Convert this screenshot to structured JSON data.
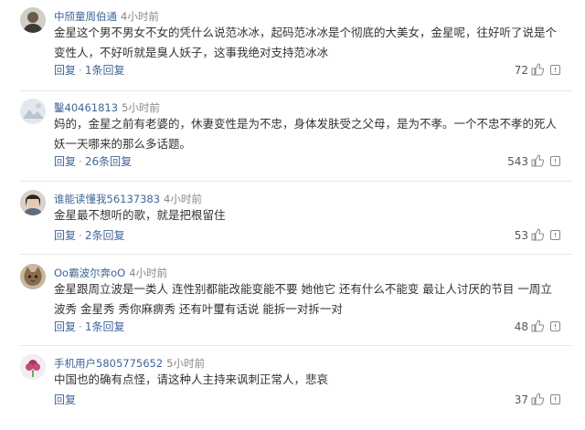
{
  "comments": [
    {
      "user": "中颀童周伯通",
      "time": "4小时前",
      "lines": [
        "金星这个男不男女不女的凭什么说范冰冰，起码范冰冰是个彻底的大美女，金星呢，往好听了说是个",
        "变性人，不好听就是臭人妖子，这事我绝对支持范冰冰"
      ],
      "reply_label": "回复",
      "replies_label": "1条回复",
      "likes": "72"
    },
    {
      "user": "鑿40461813",
      "time": "5小时前",
      "lines": [
        "妈的，金星之前有老婆的，休妻变性是为不忠，身体发肤受之父母，是为不孝。一个不忠不孝的死人",
        "妖一天哪来的那么多话题。"
      ],
      "reply_label": "回复",
      "replies_label": "26条回复",
      "likes": "543"
    },
    {
      "user": "谁能读懂我56137383",
      "time": "4小时前",
      "lines": [
        "金星最不想听的歌，就是把根留住"
      ],
      "reply_label": "回复",
      "replies_label": "2条回复",
      "likes": "53"
    },
    {
      "user": "Oo霸波尔奔oO",
      "time": "4小时前",
      "lines": [
        "金星跟周立波是一类人 连性别都能改能变能不要 她他它 还有什么不能变 最让人讨厌的节目 一周立",
        "波秀 金星秀 秀你麻痹秀 还有叶璽有话说 能拆一对拆一对"
      ],
      "reply_label": "回复",
      "replies_label": "1条回复",
      "likes": "48"
    },
    {
      "user": "手机用户5805775652",
      "time": "5小时前",
      "lines": [
        "中国也的确有点怪，请这种人主持来讽刺正常人，悲哀"
      ],
      "reply_label": "回复",
      "replies_label": "",
      "likes": "37"
    }
  ]
}
